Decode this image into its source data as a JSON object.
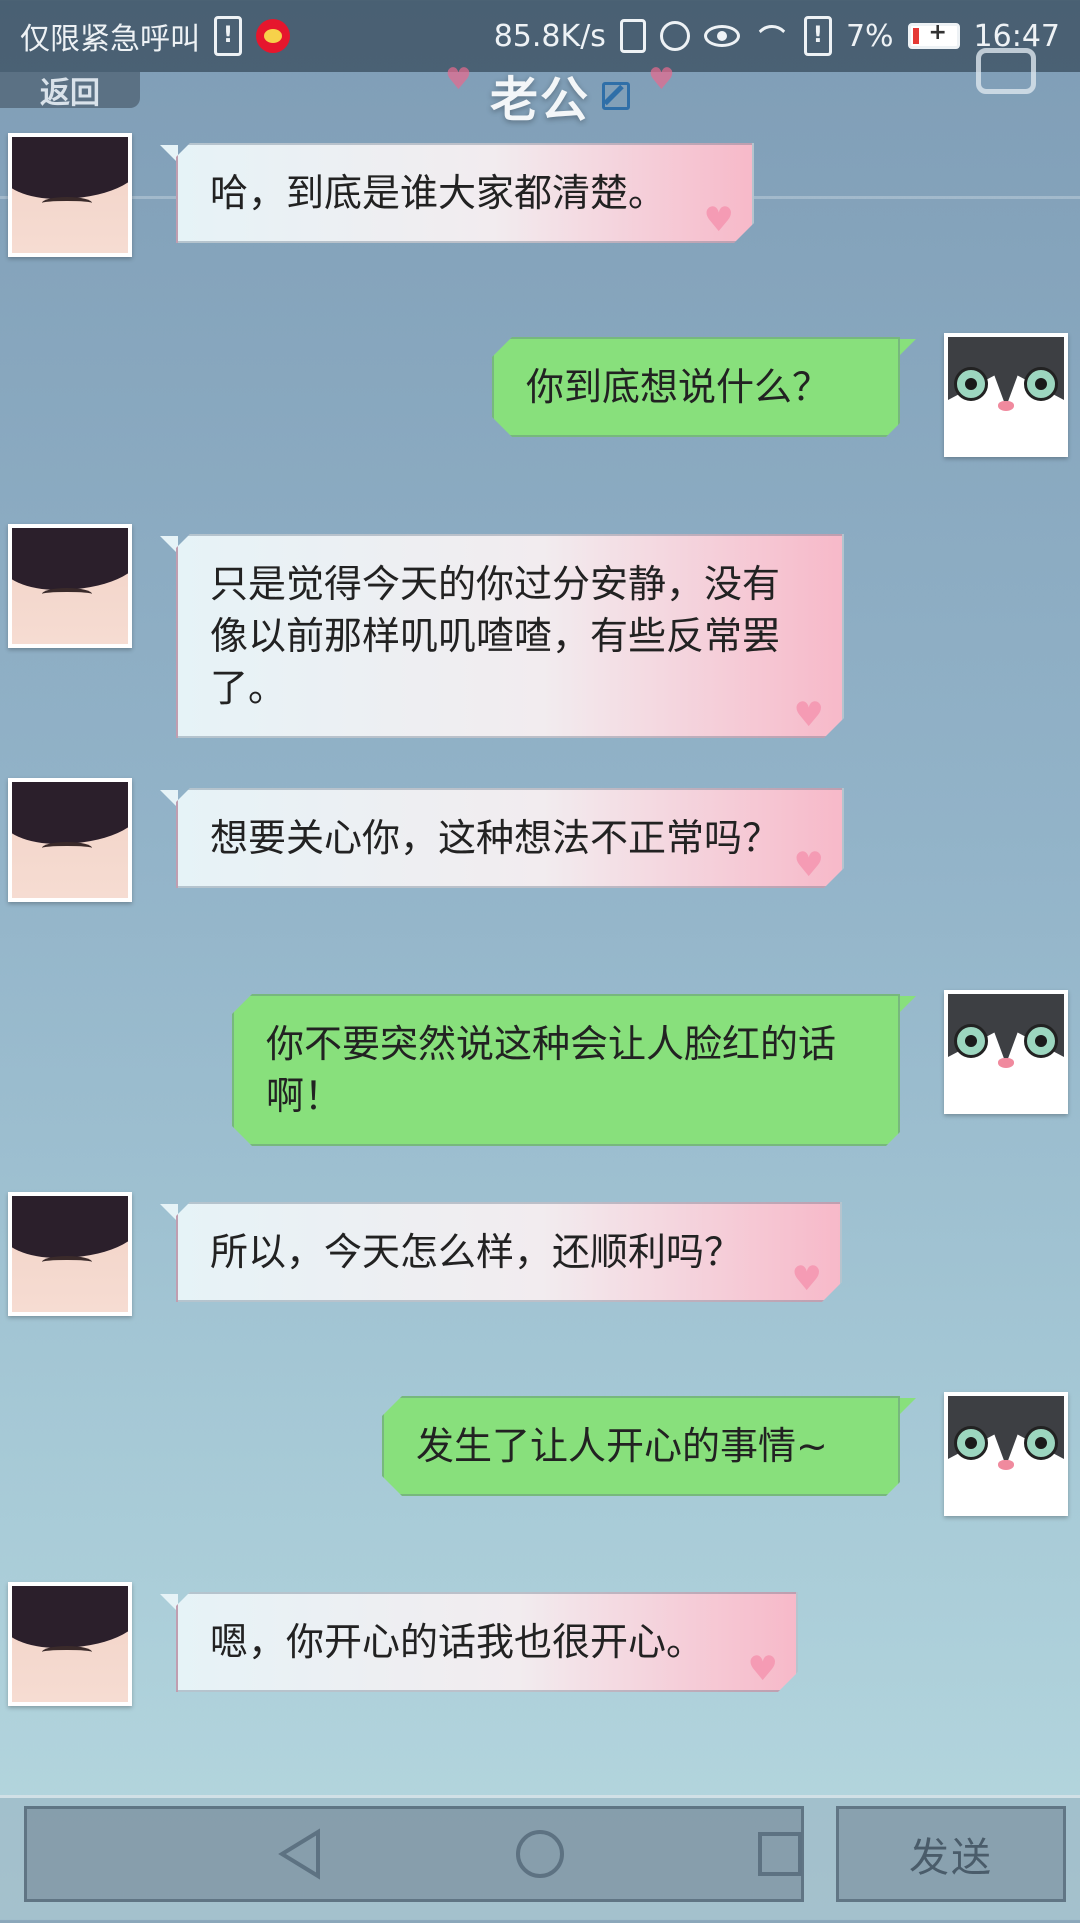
{
  "status_bar": {
    "carrier": "仅限紧急呼叫",
    "network_speed": "85.8K/s",
    "battery_percent": "7%",
    "time": "16:47"
  },
  "header": {
    "back_label": "返回",
    "title": "老公"
  },
  "messages": [
    {
      "side": "in",
      "text": "哈，到底是谁大家都清楚。"
    },
    {
      "side": "out",
      "text": "你到底想说什么？"
    },
    {
      "side": "in",
      "text": "只是觉得今天的你过分安静，没有像以前那样叽叽喳喳，有些反常罢了。"
    },
    {
      "side": "in",
      "text": "想要关心你，这种想法不正常吗？"
    },
    {
      "side": "out",
      "text": "你不要突然说这种会让人脸红的话啊！"
    },
    {
      "side": "in",
      "text": "所以，今天怎么样，还顺利吗？"
    },
    {
      "side": "out",
      "text": "发生了让人开心的事情~"
    },
    {
      "side": "in",
      "text": "嗯，你开心的话我也很开心。"
    }
  ],
  "input": {
    "value": "",
    "send_label": "发送"
  },
  "colors": {
    "incoming_bubble_start": "#e6f3f7",
    "incoming_bubble_end": "#f7b9c9",
    "outgoing_bubble": "#88e07c",
    "heart": "#f59bb4"
  }
}
